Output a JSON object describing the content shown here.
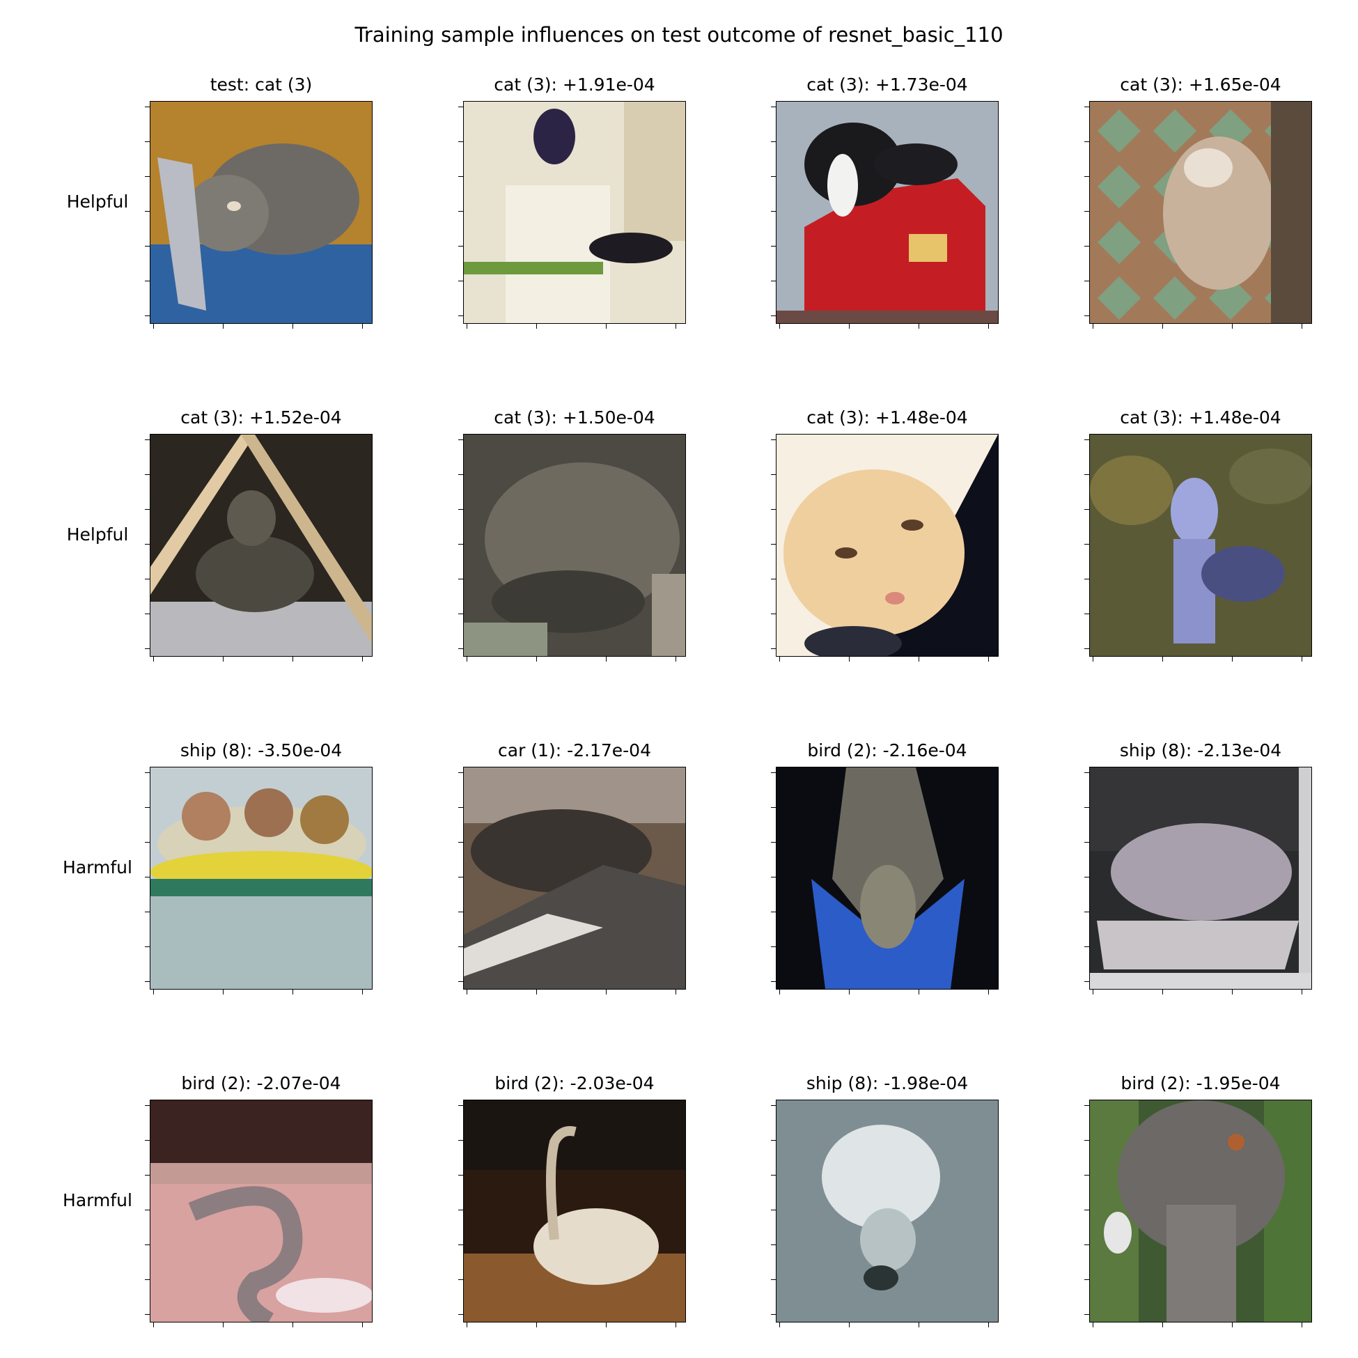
{
  "figure": {
    "title": "Training sample influences on test outcome of resnet_basic_110",
    "row_labels": [
      "Helpful",
      "Helpful",
      "Harmful",
      "Harmful"
    ]
  },
  "panels": [
    {
      "title": "test: cat (3)",
      "image": "tabby cat lying on a blue cloth against an ochre background"
    },
    {
      "title": "cat (3): +1.91e-04",
      "image": "dark cats on white shelving"
    },
    {
      "title": "cat (3): +1.73e-04",
      "image": "black and white cat on a red jacket"
    },
    {
      "title": "cat (3): +1.65e-04",
      "image": "cat on a patterned rug"
    },
    {
      "title": "cat (3): +1.52e-04",
      "image": "cat under a wooden A-frame"
    },
    {
      "title": "cat (3): +1.50e-04",
      "image": "grey tabby cat curled up"
    },
    {
      "title": "cat (3): +1.48e-04",
      "image": "cream coloured cat face"
    },
    {
      "title": "cat (3): +1.48e-04",
      "image": "pale grey-blue cat standing on foliage"
    },
    {
      "title": "ship (8): -3.50e-04",
      "image": "people on a yellow inflatable raft on water"
    },
    {
      "title": "car (1): -2.17e-04",
      "image": "brown car close-up"
    },
    {
      "title": "bird (2): -2.16e-04",
      "image": "bird head with blue plumage on black background"
    },
    {
      "title": "ship (8): -2.13e-04",
      "image": "boat on grey background"
    },
    {
      "title": "bird (2): -2.07e-04",
      "image": "grey bird neck against pink"
    },
    {
      "title": "bird (2): -2.03e-04",
      "image": "heron among dark and tan ground"
    },
    {
      "title": "ship (8): -1.98e-04",
      "image": "white shape in grey-blue water"
    },
    {
      "title": "bird (2): -1.95e-04",
      "image": "ostrich head against greenery"
    }
  ]
}
